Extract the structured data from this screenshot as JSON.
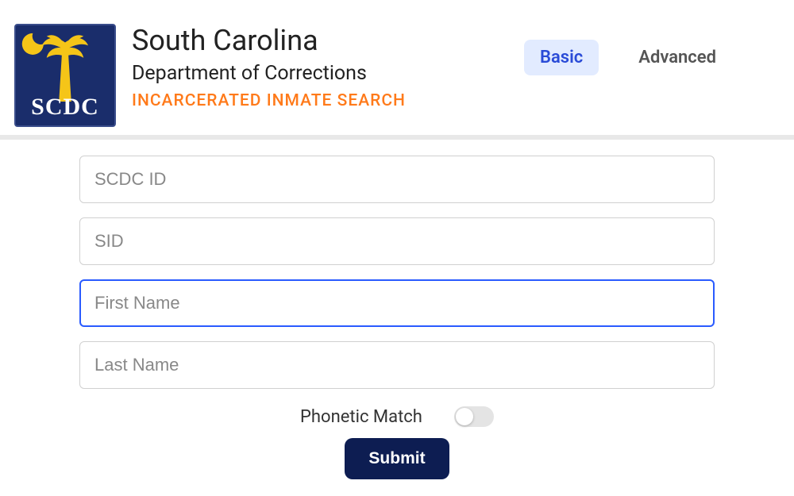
{
  "logo": {
    "abbr": "SCDC"
  },
  "header": {
    "title": "South Carolina",
    "subtitle": "Department of Corrections",
    "tagline": "INCARCERATED INMATE SEARCH"
  },
  "tabs": {
    "basic": "Basic",
    "advanced": "Advanced",
    "active": "basic"
  },
  "form": {
    "scdc_id": {
      "placeholder": "SCDC ID",
      "value": ""
    },
    "sid": {
      "placeholder": "SID",
      "value": ""
    },
    "first_name": {
      "placeholder": "First Name",
      "value": ""
    },
    "last_name": {
      "placeholder": "Last Name",
      "value": ""
    },
    "phonetic": {
      "label": "Phonetic Match",
      "checked": false
    },
    "submit": "Submit"
  }
}
